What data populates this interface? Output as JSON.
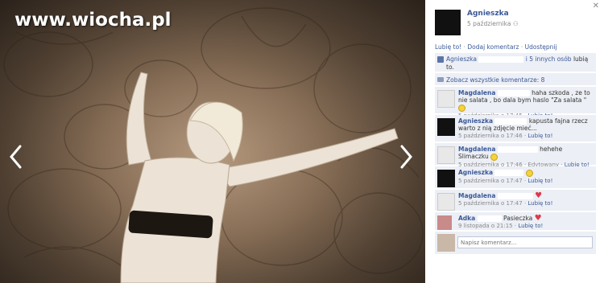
{
  "photo": {
    "watermark": "www.wiocha.pl"
  },
  "poster": {
    "name": "Agnieszka",
    "date": "5 października"
  },
  "actions": {
    "like": "Lubię to!",
    "comment": "Dodaj komentarz",
    "share": "Udostępnij",
    "separator": "·"
  },
  "likes": {
    "name": "Agnieszka",
    "others": "i 5 innych osób",
    "suffix": "lubią to."
  },
  "view_all": "Zobacz wszystkie komentarze: 8",
  "comments": [
    {
      "name": "Magdalena",
      "text": "haha szkoda , ze to nie salata , bo dala bym haslo \"Za salata \"",
      "emoji": "smile",
      "meta": "5 października o 17:45",
      "like": "Lubię to!"
    },
    {
      "name": "Agnieszka",
      "text": "kapusta fajna rzecz warto z nią zdjęcie mieć...",
      "emoji": "",
      "meta": "5 października o 17:46",
      "like": "Lubię to!"
    },
    {
      "name": "Magdalena",
      "text": "hehehe Slimaczku",
      "emoji": "smile",
      "meta": "5 października o 17:46 · Edytowany",
      "like": "Lubię to!"
    },
    {
      "name": "Agnieszka",
      "text": "",
      "emoji": "smile",
      "meta": "5 października o 17:47",
      "like": "Lubię to!"
    },
    {
      "name": "Magdalena",
      "text": "",
      "emoji": "heart",
      "meta": "5 października o 17:47",
      "like": "Lubię to!"
    },
    {
      "name": "Adka",
      "text": "Pasieczka",
      "emoji": "heart",
      "meta": "9 listopada o 21:15",
      "like": "Lubię to!"
    }
  ],
  "compose": {
    "placeholder": "Napisz komentarz..."
  },
  "colors": {
    "link": "#3b5998",
    "panel": "#eceff5",
    "meta": "#888888"
  }
}
